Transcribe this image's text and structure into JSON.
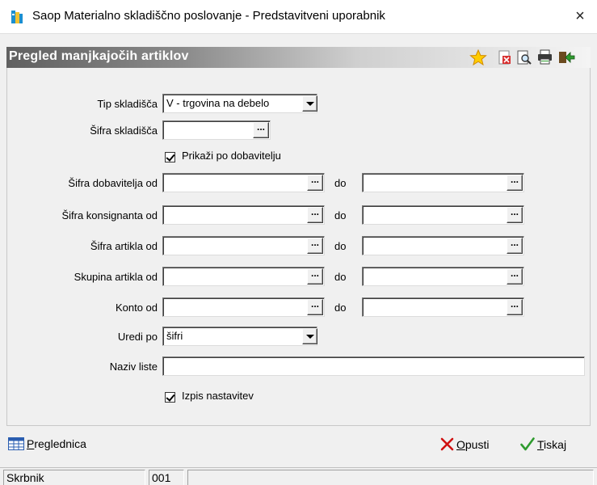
{
  "window": {
    "title": "Saop Materialno skladiščno poslovanje - Predstavitveni uporabnik",
    "close_glyph": "×"
  },
  "header": {
    "title": "Pregled manjkajočih artiklov",
    "icons": [
      "star-icon",
      "close-document-icon",
      "print-preview-icon",
      "printer-icon",
      "exit-icon"
    ]
  },
  "form": {
    "tip_skladisca": {
      "label": "Tip skladišča",
      "value": "V - trgovina na debelo"
    },
    "sifra_skladisca": {
      "label": "Šifra skladišča",
      "value": ""
    },
    "prikazi_po_dobavitelju": {
      "label": "Prikaži po dobavitelju",
      "checked": true
    },
    "ranges": [
      {
        "label": "Šifra dobavitelja od",
        "from": "",
        "to_label": "do",
        "to": ""
      },
      {
        "label": "Šifra konsignanta od",
        "from": "",
        "to_label": "do",
        "to": ""
      },
      {
        "label": "Šifra artikla od",
        "from": "",
        "to_label": "do",
        "to": ""
      },
      {
        "label": "Skupina artikla od",
        "from": "",
        "to_label": "do",
        "to": ""
      },
      {
        "label": "Konto od",
        "from": "",
        "to_label": "do",
        "to": ""
      }
    ],
    "uredi_po": {
      "label": "Uredi po",
      "value": "šifri"
    },
    "naziv_liste": {
      "label": "Naziv liste",
      "value": ""
    },
    "izpis_nastavitev": {
      "label": "Izpis nastavitev",
      "checked": true
    },
    "ellipsis": "..."
  },
  "footer": {
    "preglednica": {
      "first": "P",
      "rest": "reglednica"
    },
    "opusti": {
      "first": "O",
      "rest": "pusti"
    },
    "tiskaj": {
      "first": "T",
      "rest": "iskaj"
    }
  },
  "status": {
    "user": "Skrbnik",
    "code": "001",
    "extra": ""
  },
  "colors": {
    "accent_green": "#2e9b2e",
    "cancel_red": "#d01010",
    "header_dark": "#606060"
  }
}
